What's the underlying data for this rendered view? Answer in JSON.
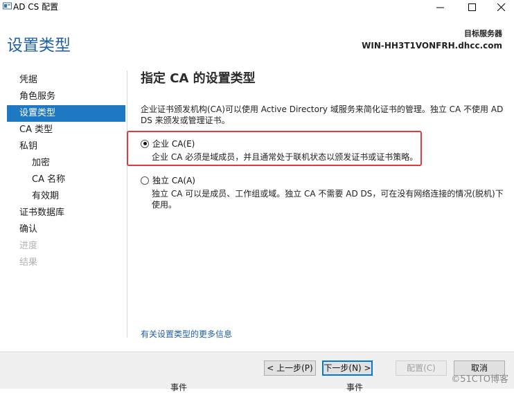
{
  "window": {
    "title": "AD CS 配置",
    "icon": "server-manager-icon",
    "controls": [
      "minimize-icon",
      "maximize-icon",
      "close-icon"
    ]
  },
  "header": {
    "page_title": "设置类型",
    "target_label": "目标服务器",
    "target_server": "WIN-HH3T1VONFRH.dhcc.com"
  },
  "sidebar": {
    "items": [
      {
        "label": "凭据",
        "state": "normal"
      },
      {
        "label": "角色服务",
        "state": "normal"
      },
      {
        "label": "设置类型",
        "state": "active"
      },
      {
        "label": "CA 类型",
        "state": "normal"
      },
      {
        "label": "私钥",
        "state": "normal"
      },
      {
        "label": "加密",
        "state": "sub"
      },
      {
        "label": "CA 名称",
        "state": "sub"
      },
      {
        "label": "有效期",
        "state": "sub"
      },
      {
        "label": "证书数据库",
        "state": "normal"
      },
      {
        "label": "确认",
        "state": "normal"
      },
      {
        "label": "进度",
        "state": "disabled"
      },
      {
        "label": "结果",
        "state": "disabled"
      }
    ]
  },
  "main": {
    "heading": "指定 CA 的设置类型",
    "intro": "企业证书颁发机构(CA)可以使用 Active Directory 域服务来简化证书的管理。独立 CA 不使用 AD DS 来颁发或管理证书。",
    "options": [
      {
        "label": "企业 CA(E)",
        "description": "企业 CA 必须是域成员，并且通常处于联机状态以颁发证书或证书策略。",
        "selected": true
      },
      {
        "label": "独立 CA(A)",
        "description": "独立 CA 可以是成员、工作组或域。独立 CA 不需要 AD DS，可在没有网络连接的情况(脱机)下使用。",
        "selected": false
      }
    ],
    "more_info_link": "有关设置类型的更多信息"
  },
  "footer": {
    "back": "< 上一步(P)",
    "next": "下一步(N) >",
    "configure": "配置(C)",
    "cancel": "取消",
    "partial_left": "事件",
    "partial_right": "事件",
    "watermark": "©51CTO博客"
  },
  "colors": {
    "accent": "#1f79c2",
    "title_blue": "#1e5fa8",
    "highlight_red": "#e0393e"
  }
}
